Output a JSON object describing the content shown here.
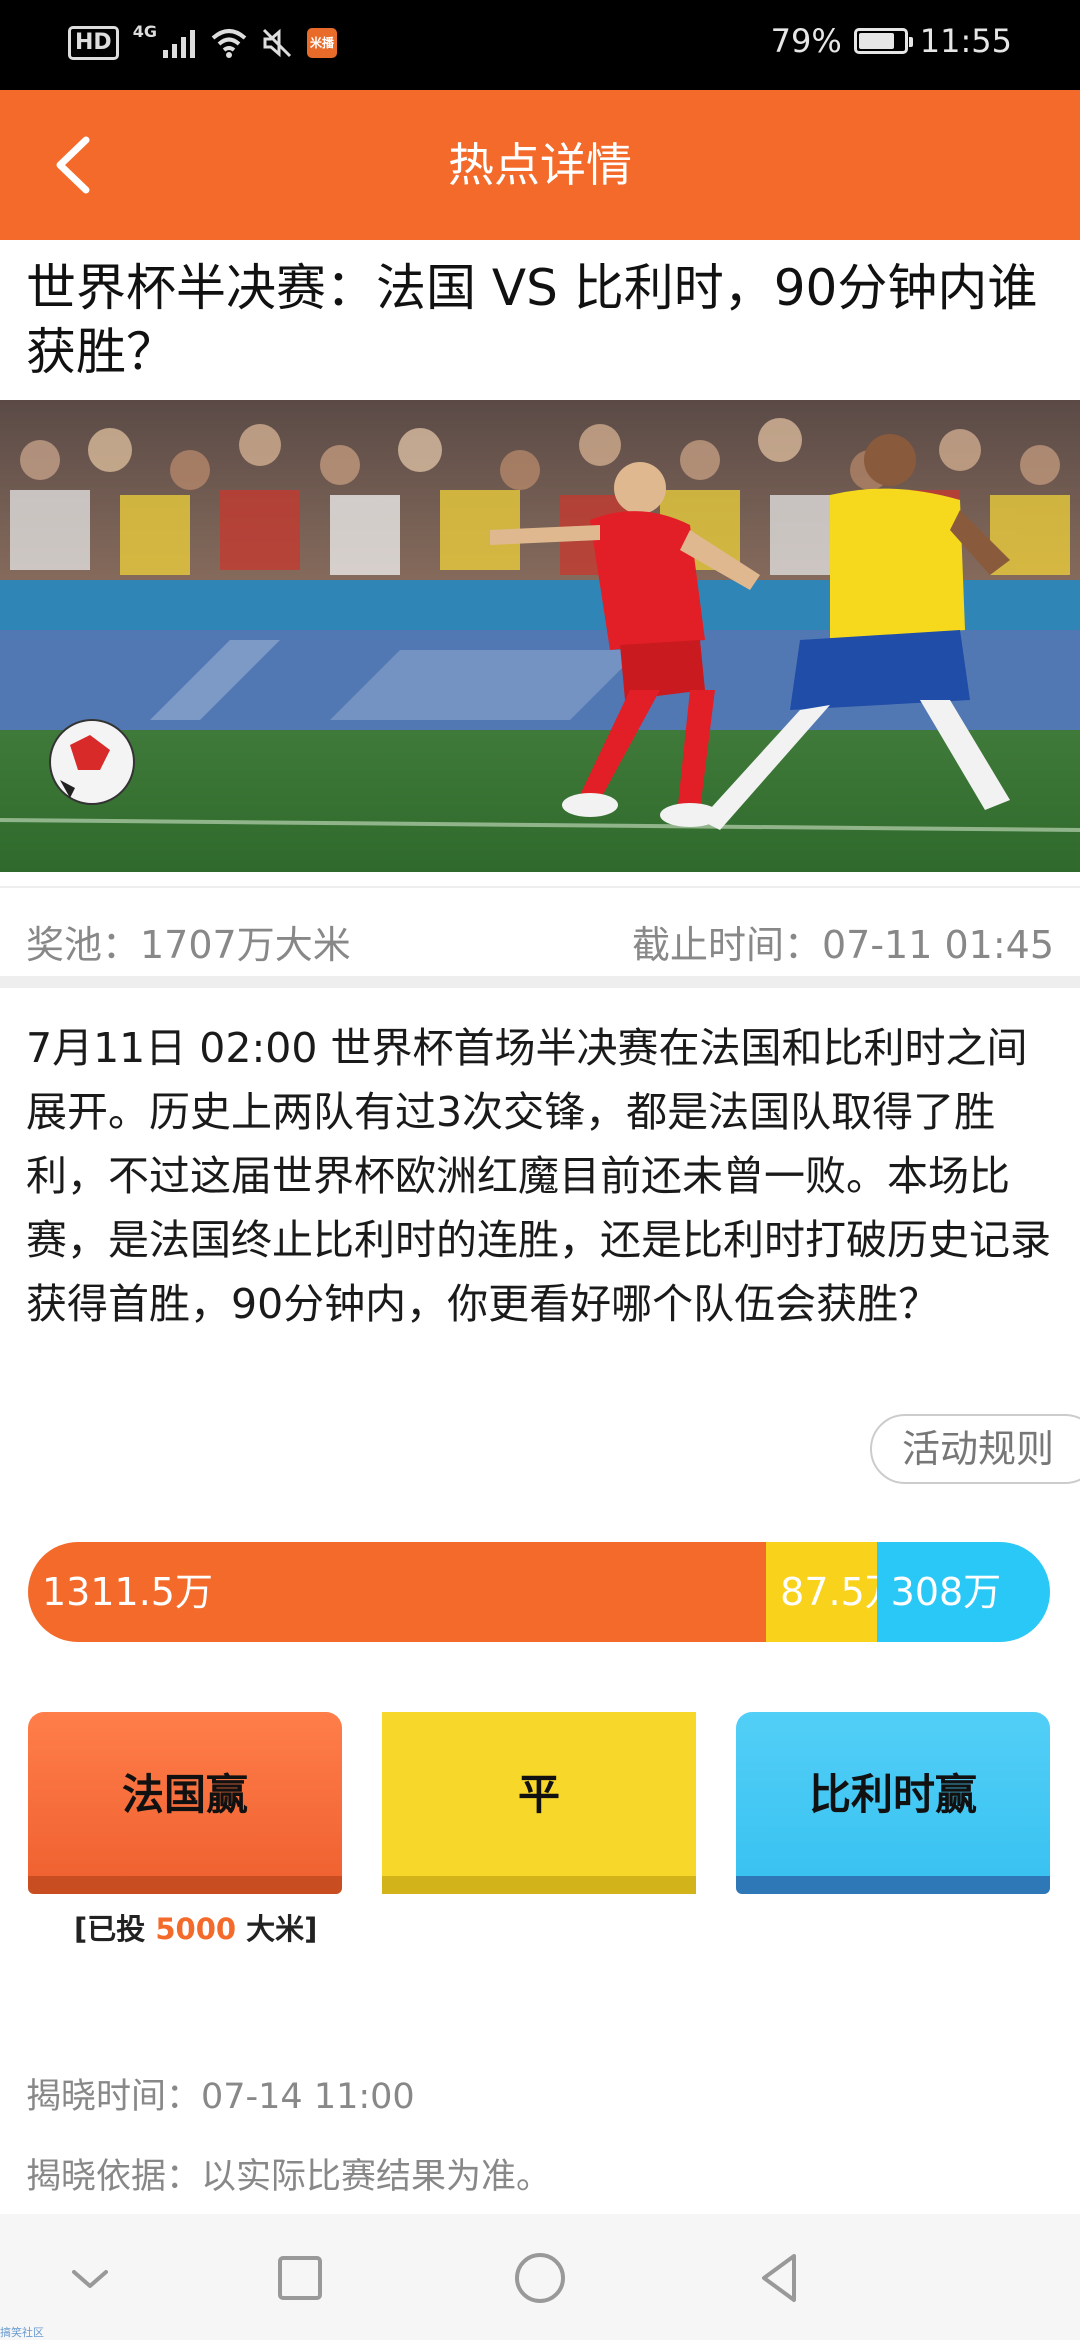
{
  "status_bar": {
    "hd": "HD",
    "network": "4G",
    "app_badge": "米播",
    "battery_percent": "79%",
    "battery_level": 0.79,
    "time": "11:55"
  },
  "nav": {
    "title": "热点详情"
  },
  "article": {
    "title": "世界杯半决赛：法国 VS 比利时，90分钟内谁获胜？",
    "pool": "奖池：1707万大米",
    "deadline": "截止时间：07-11 01:45",
    "description": "7月11日 02:00 世界杯首场半决赛在法国和比利时之间展开。历史上两队有过3次交锋，都是法国队取得了胜利，不过这届世界杯欧洲红魔目前还未曾一败。本场比赛，是法国终止比利时的连胜，还是比利时打破历史记录获得首胜，90分钟内，你更看好哪个队伍会获胜？"
  },
  "rules_button": "活动规则",
  "odds": [
    {
      "label": "1311.5万",
      "amount": 1311.5,
      "color": "#f36a2b"
    },
    {
      "label": "87.5万",
      "amount": 87.5,
      "color": "#f9d21c"
    },
    {
      "label": "308万",
      "amount": 308,
      "color": "#29c8f6"
    }
  ],
  "bets": {
    "france": "法国赢",
    "draw": "平",
    "belgium": "比利时赢"
  },
  "placed": {
    "prefix": "[已投 ",
    "amount": "5000",
    "suffix": " 大米]"
  },
  "reveal": {
    "time": "揭晓时间：07-14 11:00",
    "basis": "揭晓依据：以实际比赛结果为准。"
  },
  "watermark": "搞笑社区"
}
